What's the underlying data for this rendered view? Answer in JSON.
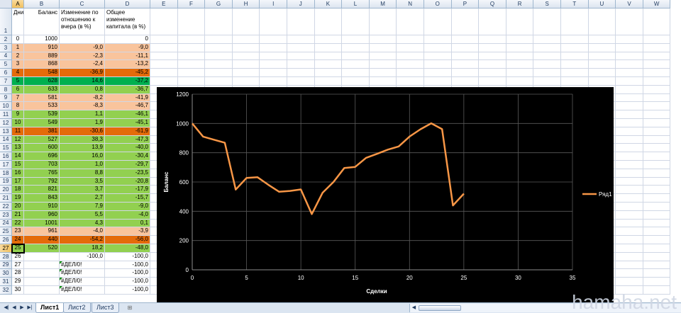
{
  "columns": [
    "A",
    "B",
    "C",
    "D",
    "E",
    "F",
    "G",
    "H",
    "I",
    "J",
    "K",
    "L",
    "M",
    "N",
    "O",
    "P",
    "Q",
    "R",
    "S",
    "T",
    "U",
    "V",
    "W"
  ],
  "selected_column": "A",
  "selected_row": 27,
  "header_cells": {
    "A": "Дни",
    "B": "Баланс",
    "C": "Изменение по отношению к вчера (в %)",
    "D": "Общее изменение капитала (в %)"
  },
  "rows": [
    {
      "n": 2,
      "a": "0",
      "b": "1000",
      "c": "",
      "d": "0",
      "fill": "#ffffff"
    },
    {
      "n": 3,
      "a": "1",
      "b": "910",
      "c": "-9,0",
      "d": "-9,0",
      "fill": "#f9c49c"
    },
    {
      "n": 4,
      "a": "2",
      "b": "889",
      "c": "-2,3",
      "d": "-11,1",
      "fill": "#f9c49c"
    },
    {
      "n": 5,
      "a": "3",
      "b": "868",
      "c": "-2,4",
      "d": "-13,2",
      "fill": "#f9c49c"
    },
    {
      "n": 6,
      "a": "4",
      "b": "548",
      "c": "-36,9",
      "d": "-45,2",
      "fill": "#e46b0a"
    },
    {
      "n": 7,
      "a": "5",
      "b": "628",
      "c": "14,6",
      "d": "-37,2",
      "fill": "#00b04f"
    },
    {
      "n": 8,
      "a": "6",
      "b": "633",
      "c": "0,8",
      "d": "-36,7",
      "fill": "#92d050"
    },
    {
      "n": 9,
      "a": "7",
      "b": "581",
      "c": "-8,2",
      "d": "-41,9",
      "fill": "#f9c49c"
    },
    {
      "n": 10,
      "a": "8",
      "b": "533",
      "c": "-8,3",
      "d": "-46,7",
      "fill": "#f9c49c"
    },
    {
      "n": 11,
      "a": "9",
      "b": "539",
      "c": "1,1",
      "d": "-46,1",
      "fill": "#92d050"
    },
    {
      "n": 12,
      "a": "10",
      "b": "549",
      "c": "1,9",
      "d": "-45,1",
      "fill": "#92d050"
    },
    {
      "n": 13,
      "a": "11",
      "b": "381",
      "c": "-30,6",
      "d": "-61,9",
      "fill": "#e46b0a"
    },
    {
      "n": 14,
      "a": "12",
      "b": "527",
      "c": "38,3",
      "d": "-47,3",
      "fill": "#92d050"
    },
    {
      "n": 15,
      "a": "13",
      "b": "600",
      "c": "13,9",
      "d": "-40,0",
      "fill": "#92d050"
    },
    {
      "n": 16,
      "a": "14",
      "b": "696",
      "c": "16,0",
      "d": "-30,4",
      "fill": "#92d050"
    },
    {
      "n": 17,
      "a": "15",
      "b": "703",
      "c": "1,0",
      "d": "-29,7",
      "fill": "#92d050"
    },
    {
      "n": 18,
      "a": "16",
      "b": "765",
      "c": "8,8",
      "d": "-23,5",
      "fill": "#92d050"
    },
    {
      "n": 19,
      "a": "17",
      "b": "792",
      "c": "3,5",
      "d": "-20,8",
      "fill": "#92d050"
    },
    {
      "n": 20,
      "a": "18",
      "b": "821",
      "c": "3,7",
      "d": "-17,9",
      "fill": "#92d050"
    },
    {
      "n": 21,
      "a": "19",
      "b": "843",
      "c": "2,7",
      "d": "-15,7",
      "fill": "#92d050"
    },
    {
      "n": 22,
      "a": "20",
      "b": "910",
      "c": "7,9",
      "d": "-9,0",
      "fill": "#92d050"
    },
    {
      "n": 23,
      "a": "21",
      "b": "960",
      "c": "5,5",
      "d": "-4,0",
      "fill": "#92d050"
    },
    {
      "n": 24,
      "a": "22",
      "b": "1001",
      "c": "4,3",
      "d": "0,1",
      "fill": "#92d050"
    },
    {
      "n": 25,
      "a": "23",
      "b": "961",
      "c": "-4,0",
      "d": "-3,9",
      "fill": "#f9c49c"
    },
    {
      "n": 26,
      "a": "24",
      "b": "440",
      "c": "-54,2",
      "d": "-56,0",
      "fill": "#e46b0a"
    },
    {
      "n": 27,
      "a": "25",
      "b": "520",
      "c": "18,2",
      "d": "-48,0",
      "fill": "#92d050"
    },
    {
      "n": 28,
      "a": "26",
      "b": "",
      "c": "-100,0",
      "d": "-100,0",
      "fill": "#ffffff"
    },
    {
      "n": 29,
      "a": "27",
      "b": "",
      "c": "#ДЕЛ/0!",
      "d": "-100,0",
      "fill": "#ffffff",
      "err": true
    },
    {
      "n": 30,
      "a": "28",
      "b": "",
      "c": "#ДЕЛ/0!",
      "d": "-100,0",
      "fill": "#ffffff",
      "err": true
    },
    {
      "n": 31,
      "a": "29",
      "b": "",
      "c": "#ДЕЛ/0!",
      "d": "-100,0",
      "fill": "#ffffff",
      "err": true
    },
    {
      "n": 32,
      "a": "30",
      "b": "",
      "c": "#ДЕЛ/0!",
      "d": "-100,0",
      "fill": "#ffffff",
      "err": true
    }
  ],
  "sheet_tabs": [
    {
      "label": "Лист1",
      "active": true
    },
    {
      "label": "Лист2",
      "active": false
    },
    {
      "label": "Лист3",
      "active": false
    }
  ],
  "icons": {
    "nav_first": "first-sheet-icon",
    "nav_prev": "prev-sheet-icon",
    "nav_next": "next-sheet-icon",
    "nav_last": "last-sheet-icon",
    "new_sheet": "insert-sheet-icon"
  },
  "chart_data": {
    "type": "line",
    "background": "#000000",
    "line_color": "#f79646",
    "grid": true,
    "legend": "right",
    "xlabel": "Сделки",
    "ylabel": "Баланс",
    "xlim": [
      0,
      35
    ],
    "ylim": [
      0,
      1200
    ],
    "xticks": [
      0,
      5,
      10,
      15,
      20,
      25,
      30,
      35
    ],
    "yticks": [
      0,
      200,
      400,
      600,
      800,
      1000,
      1200
    ],
    "series": [
      {
        "name": "Ряд1",
        "x": [
          0,
          1,
          2,
          3,
          4,
          5,
          6,
          7,
          8,
          9,
          10,
          11,
          12,
          13,
          14,
          15,
          16,
          17,
          18,
          19,
          20,
          21,
          22,
          23,
          24,
          25
        ],
        "y": [
          1000,
          910,
          889,
          868,
          548,
          628,
          633,
          581,
          533,
          539,
          549,
          381,
          527,
          600,
          696,
          703,
          765,
          792,
          821,
          843,
          910,
          960,
          1001,
          961,
          440,
          520
        ]
      }
    ]
  },
  "watermark": "hamaha.net"
}
